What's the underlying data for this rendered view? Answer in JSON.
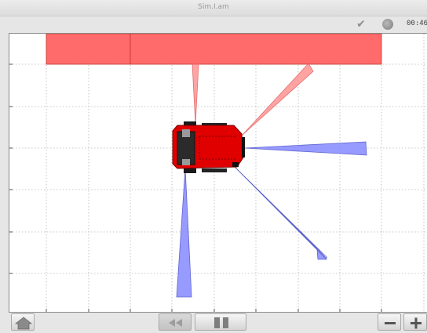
{
  "window": {
    "title": "Sim.I.am"
  },
  "status": {
    "icons": [
      "check-icon",
      "clock-icon"
    ],
    "timer": "00:46"
  },
  "simulation": {
    "obstacle_color": "#ff6b6b",
    "robot_body_color": "#e00000",
    "sensor_detect_color": "#ff9a9a",
    "sensor_clear_color": "#8c90ff",
    "sensor_count": 5,
    "sensors_detecting": 2
  },
  "toolbar": {
    "buttons": [
      "home-button",
      "rewind-button",
      "pause-button",
      "zoom-out-button",
      "zoom-in-button"
    ]
  }
}
